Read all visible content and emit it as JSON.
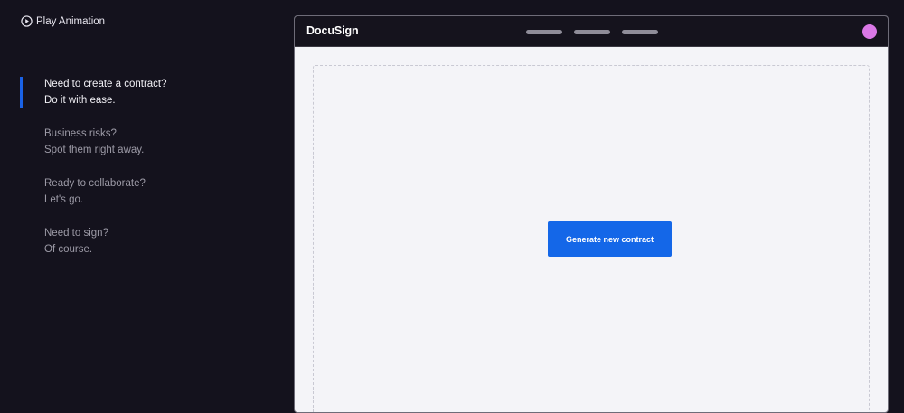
{
  "controls": {
    "play_label": "Play Animation",
    "play_icon": "play-circle-icon"
  },
  "steps": [
    {
      "line1": "Need to create a contract?",
      "line2": "Do it with ease.",
      "active": true
    },
    {
      "line1": "Business risks?",
      "line2": "Spot them right away.",
      "active": false
    },
    {
      "line1": "Ready to collaborate?",
      "line2": "Let's go.",
      "active": false
    },
    {
      "line1": "Need to sign?",
      "line2": "Of course.",
      "active": false
    }
  ],
  "app": {
    "logo": "DocuSign",
    "avatar_color": "#da78e6",
    "primary_button_label": "Generate new contract"
  },
  "colors": {
    "background": "#14121d",
    "accent": "#1a62e6",
    "button": "#1467e8",
    "canvas": "#f4f4f8"
  }
}
